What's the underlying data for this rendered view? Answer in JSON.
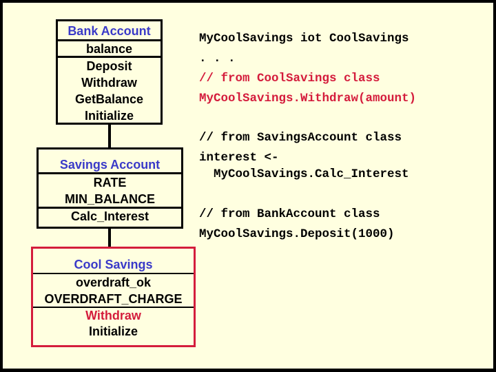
{
  "diagram": {
    "classes": [
      {
        "name": "Bank Account",
        "attributes": [
          "balance"
        ],
        "methods": [
          {
            "label": "Deposit",
            "highlight": false
          },
          {
            "label": "Withdraw",
            "highlight": false
          },
          {
            "label": "GetBalance",
            "highlight": false
          },
          {
            "label": "Initialize",
            "highlight": false
          }
        ]
      },
      {
        "name": "Savings Account",
        "attributes": [
          "RATE",
          "MIN_BALANCE"
        ],
        "methods": [
          {
            "label": "Calc_Interest",
            "highlight": false
          }
        ]
      },
      {
        "name": "Cool Savings",
        "highlighted_box": true,
        "attributes": [
          "overdraft_ok",
          "OVERDRAFT_CHARGE"
        ],
        "methods": [
          {
            "label": "Withdraw",
            "highlight": true
          },
          {
            "label": "Initialize",
            "highlight": false
          }
        ]
      }
    ]
  },
  "code": {
    "lines": [
      {
        "text": "MyCoolSavings iot CoolSavings",
        "color": "black"
      },
      {
        "text": ". . .",
        "color": "black"
      },
      {
        "text": "// from CoolSavings class",
        "color": "red"
      },
      {
        "text": "MyCoolSavings.Withdraw(amount)",
        "color": "red"
      },
      {
        "text": "// from SavingsAccount class",
        "color": "black"
      },
      {
        "text": "interest <-",
        "color": "black"
      },
      {
        "text": "  MyCoolSavings.Calc_Interest",
        "color": "black"
      },
      {
        "text": "// from BankAccount class",
        "color": "black"
      },
      {
        "text": "MyCoolSavings.Deposit(1000)",
        "color": "black"
      }
    ]
  },
  "colors": {
    "background": "#FFFFE0",
    "frame": "#000000",
    "class_title": "#3A3AC8",
    "highlight": "#D41C3C"
  }
}
